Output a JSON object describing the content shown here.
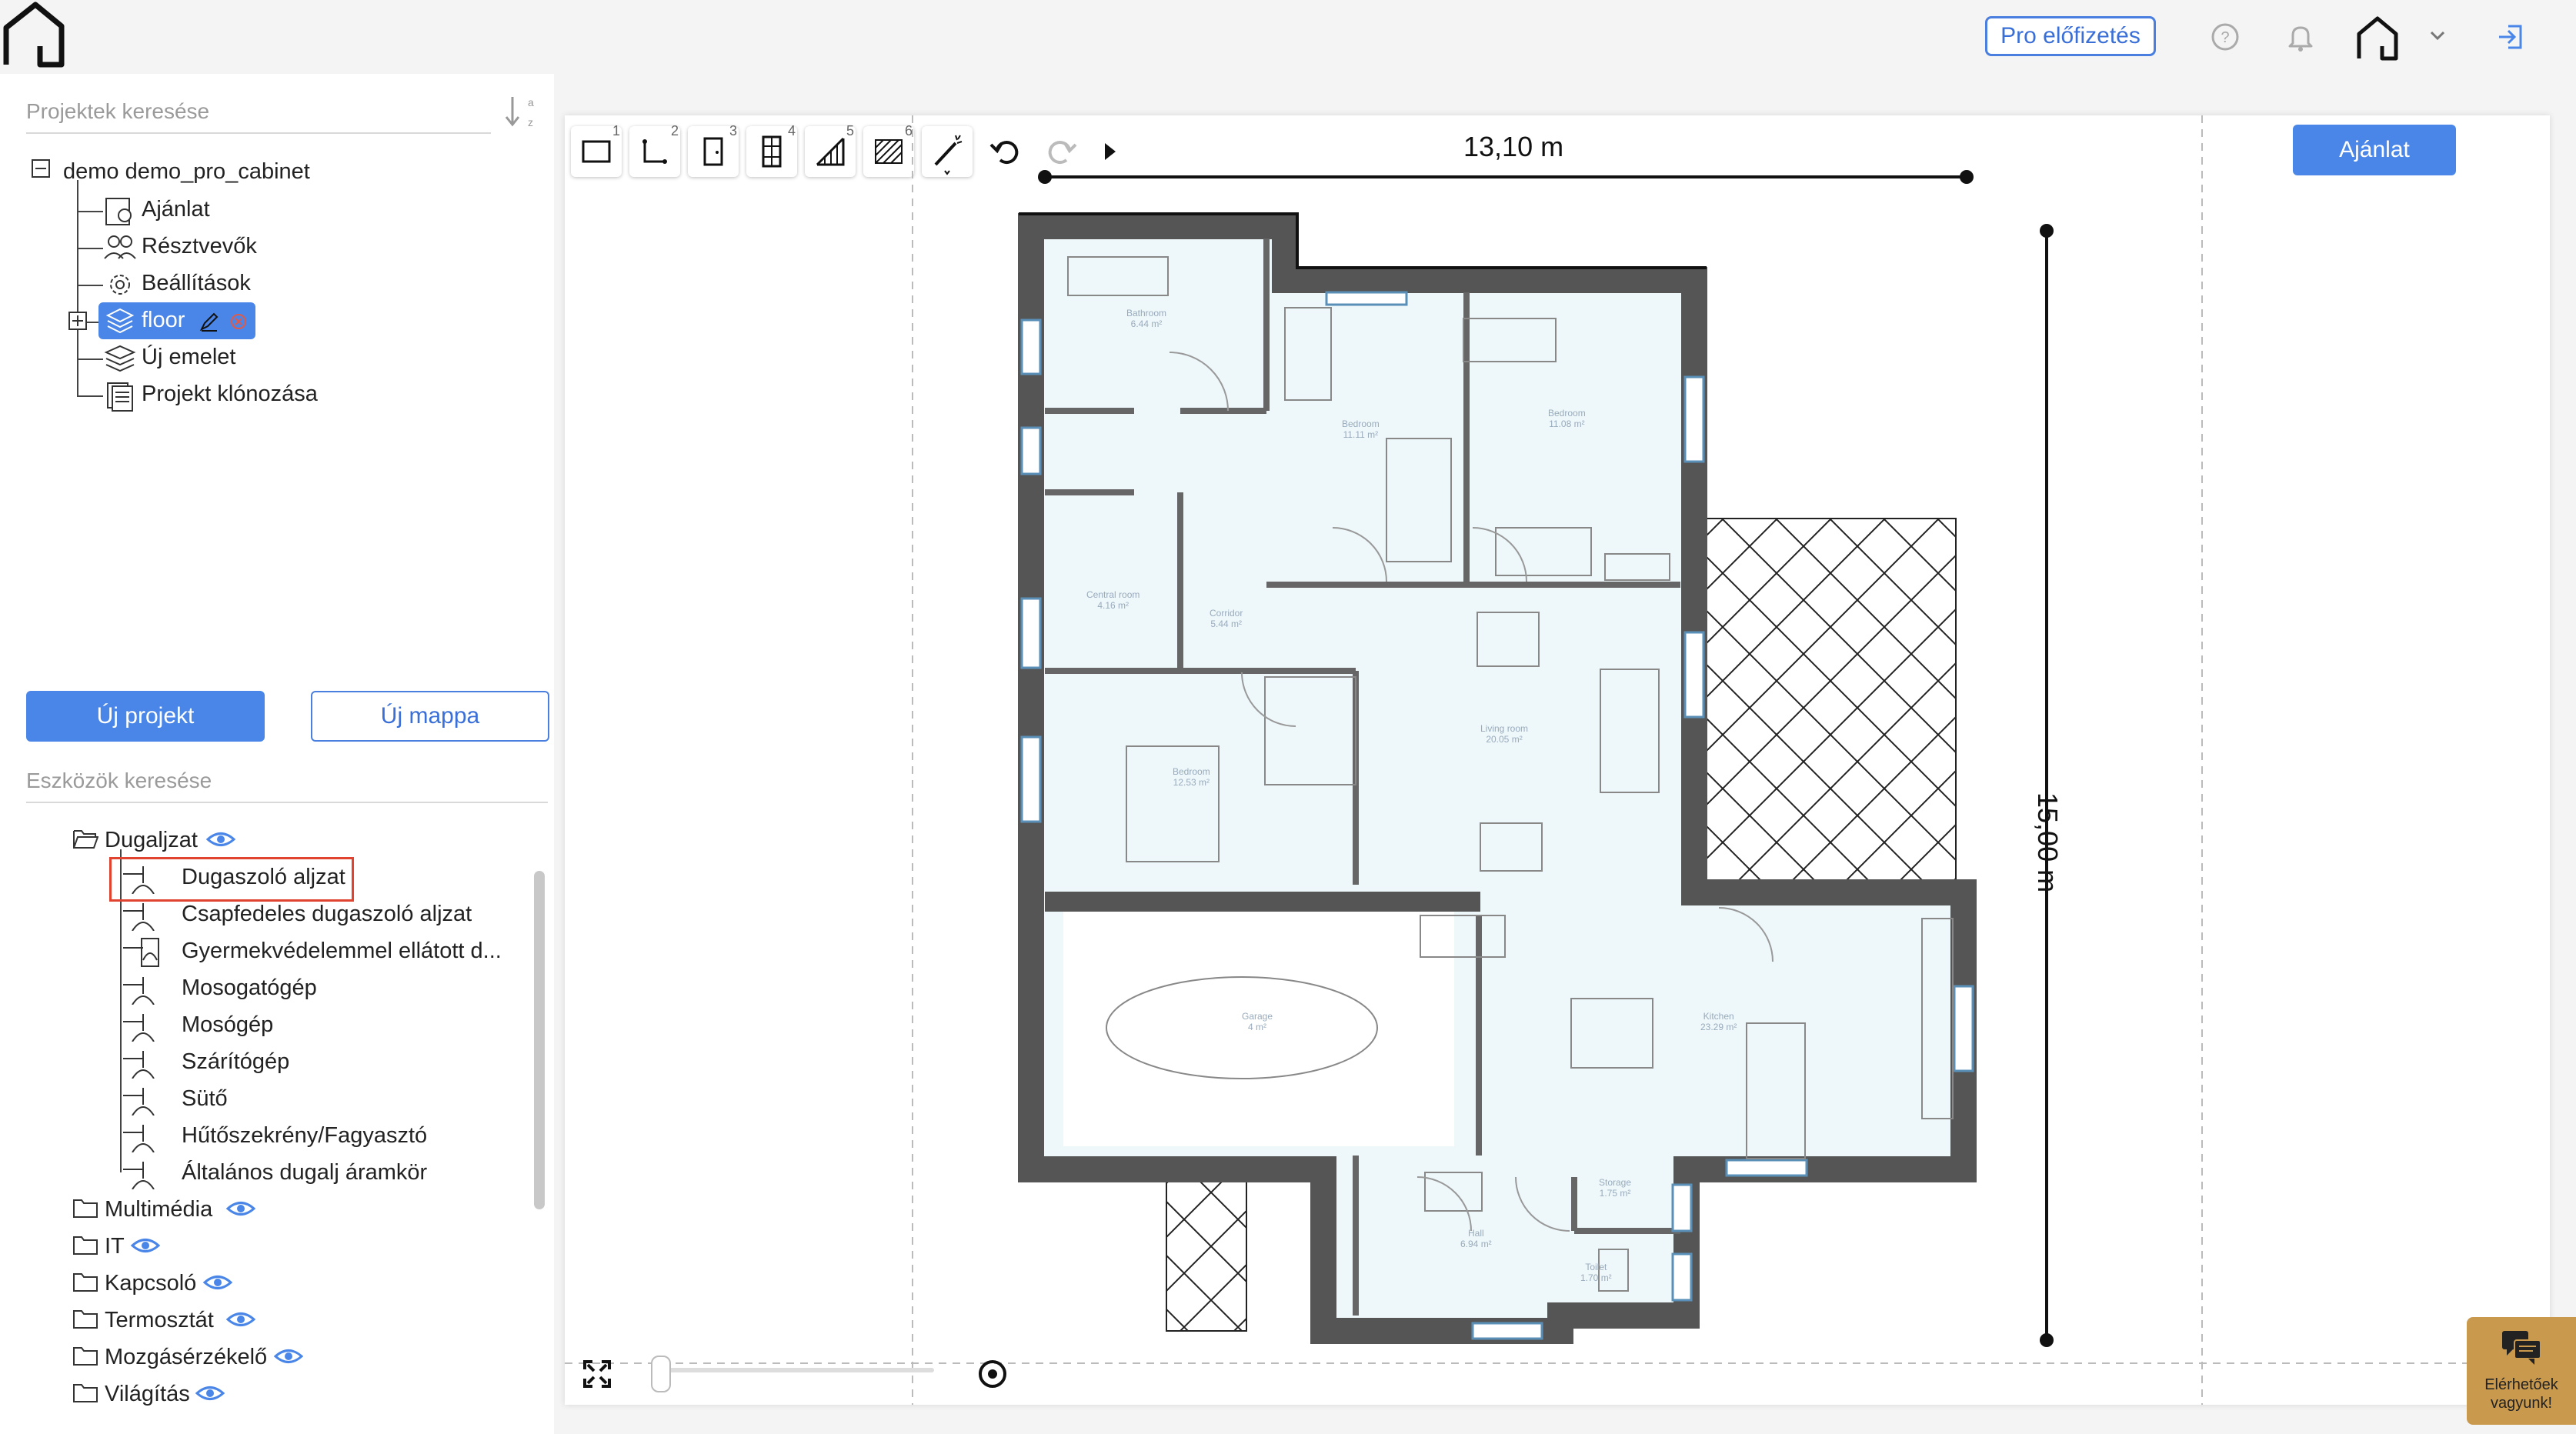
{
  "topbar": {
    "pro_label": "Pro előfizetés",
    "icons": [
      "home-logo-icon",
      "help-icon",
      "bell-icon",
      "home-user-icon",
      "chevron-down-icon",
      "logout-icon"
    ]
  },
  "projects": {
    "search_placeholder": "Projektek keresése",
    "root": "demo demo_pro_cabinet",
    "items": [
      "Ajánlat",
      "Résztvevők",
      "Beállítások",
      "floor",
      "Új emelet",
      "Projekt klónozása"
    ]
  },
  "buttons": {
    "new_project": "Új projekt",
    "new_folder": "Új mappa"
  },
  "tools": {
    "search_placeholder": "Eszközök keresése",
    "category_open": "Dugaljzat",
    "sockets": [
      "Dugaszoló aljzat",
      "Csapfedeles dugaszoló aljzat",
      "Gyermekvédelemmel ellátott d...",
      "Mosogatógép",
      "Mosógép",
      "Szárítógép",
      "Sütő",
      "Hűtőszekrény/Fagyasztó",
      "Általános dugalj áramkör"
    ],
    "categories": [
      "Multimédia",
      "IT",
      "Kapcsoló",
      "Termosztát",
      "Mozgásérzékelő",
      "Világítás"
    ]
  },
  "canvas": {
    "toolbar_numbers": [
      "1",
      "2",
      "3",
      "4",
      "5",
      "6"
    ],
    "offer_label": "Ajánlat",
    "width_dim": "13,10 m",
    "height_dim": "15,00 m",
    "rooms": [
      {
        "name": "Bathroom",
        "area": "6.44 m²"
      },
      {
        "name": "Bedroom",
        "area": "11.11 m²"
      },
      {
        "name": "Bedroom",
        "area": "11.08 m²"
      },
      {
        "name": "Central room",
        "area": "4.16 m²"
      },
      {
        "name": "Corridor",
        "area": "5.44 m²"
      },
      {
        "name": "Living room",
        "area": "20.05 m²"
      },
      {
        "name": "Bedroom",
        "area": "12.53 m²"
      },
      {
        "name": "Garage",
        "area": "4 m²"
      },
      {
        "name": "Kitchen",
        "area": "23.29 m²"
      },
      {
        "name": "Hall",
        "area": "6.94 m²"
      },
      {
        "name": "Storage",
        "area": "1.75 m²"
      },
      {
        "name": "Toilet",
        "area": "1.70 m²"
      }
    ]
  },
  "chat": {
    "label": "Elérhetőek vagyunk!"
  },
  "colors": {
    "accent": "#4a86e8",
    "wall": "#555555",
    "room_fill": "#eef8fb",
    "highlight": "#e0432f"
  }
}
